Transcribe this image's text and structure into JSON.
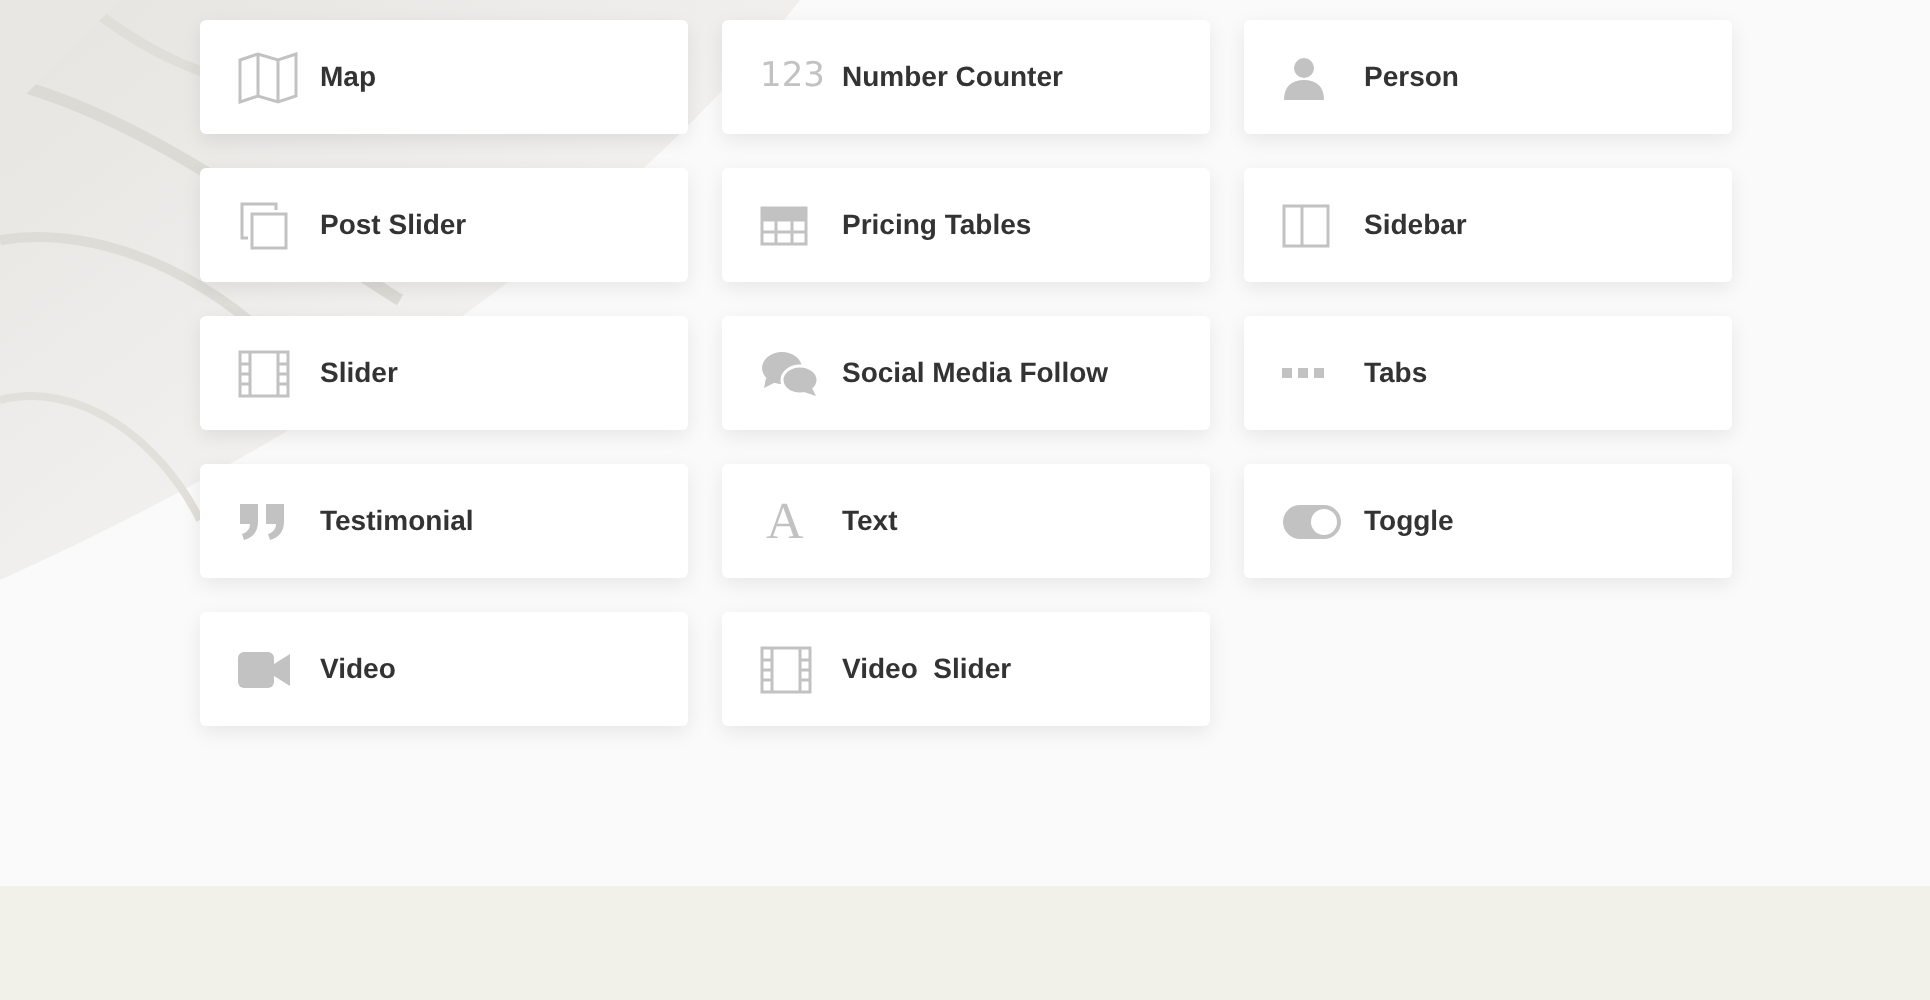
{
  "modules": [
    {
      "label": "Map"
    },
    {
      "label": "Number Counter",
      "glyph": "123"
    },
    {
      "label": "Person"
    },
    {
      "label": "Post Slider"
    },
    {
      "label": "Pricing Tables"
    },
    {
      "label": "Sidebar"
    },
    {
      "label": "Slider"
    },
    {
      "label": "Social Media Follow"
    },
    {
      "label": "Tabs"
    },
    {
      "label": "Testimonial"
    },
    {
      "label": "Text",
      "glyph": "A"
    },
    {
      "label": "Toggle"
    },
    {
      "label": "Video"
    },
    {
      "label": "Video  Slider"
    }
  ]
}
